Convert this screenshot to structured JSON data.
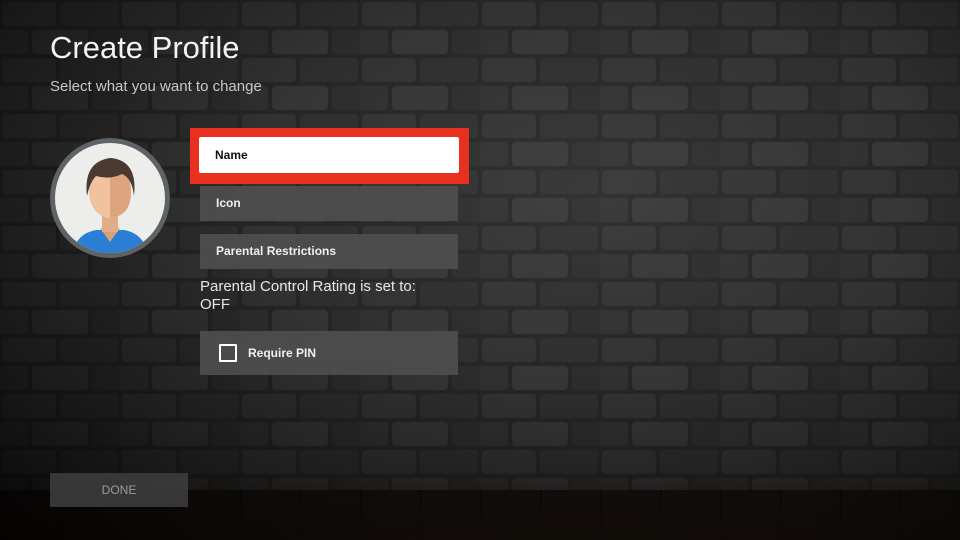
{
  "header": {
    "title": "Create Profile",
    "subtitle": "Select what you want to change"
  },
  "avatar": {
    "icon": "default-person-avatar"
  },
  "menu": {
    "name_label": "Name",
    "icon_label": "Icon",
    "parental_label": "Parental Restrictions",
    "focused_item": "Name"
  },
  "parental_status": {
    "text": "Parental Control Rating is set to:",
    "value": "OFF"
  },
  "require_pin": {
    "label": "Require PIN",
    "checked": false
  },
  "footer": {
    "done_label": "DONE"
  },
  "colors": {
    "focus_accent": "#e8301e",
    "button_bg": "#4e4e4e",
    "focused_button_bg": "#ffffff",
    "text": "#f0f0f0"
  }
}
